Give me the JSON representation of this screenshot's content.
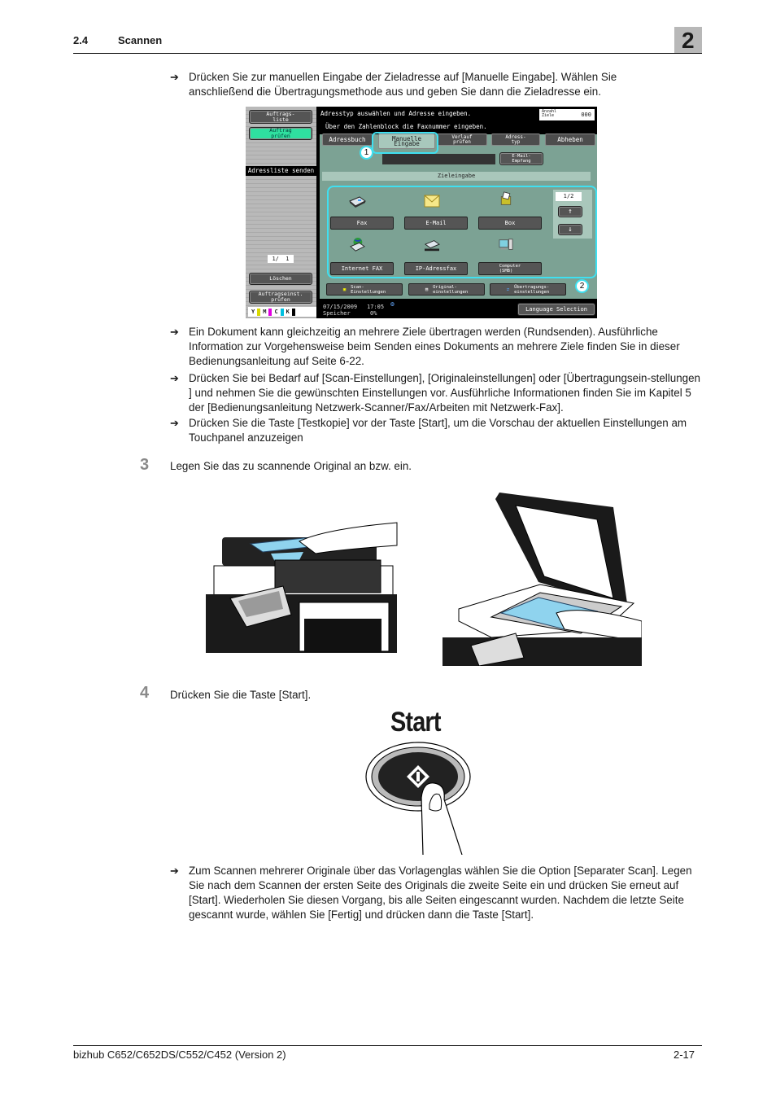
{
  "header": {
    "section_number": "2.4",
    "section_title": "Scannen",
    "chapter_number": "2"
  },
  "intro_bullet": "Drücken Sie zur manuellen Eingabe der Zieladresse auf [Manuelle Eingabe]. Wählen Sie anschließend die Übertragungsmethode aus und geben Sie dann die Zieladresse ein.",
  "touch_panel": {
    "left_panel": {
      "job_list_button": "Auftrags-\nliste",
      "check_job_button": "Auftrag\nprüfen",
      "address_list_label": "Adressliste senden",
      "page_counter": "1/  1",
      "delete_button": "Löschen",
      "check_job_settings_button": "Auftragseinst.\nprüfen",
      "toner": [
        {
          "label": "Y",
          "color": "#d8d800"
        },
        {
          "label": "M",
          "color": "#e000e0"
        },
        {
          "label": "C",
          "color": "#00c0e0"
        },
        {
          "label": "K",
          "color": "#000000"
        }
      ]
    },
    "message_line1": "Adresstyp auswählen und Adresse eingeben.",
    "message_line2": "Über den Zahlenblock die Faxnummer eingeben.",
    "dest_count_label": "Anzahl\nZiele",
    "dest_count_value": "000",
    "tabs": [
      {
        "label": "Adressbuch",
        "active": false
      },
      {
        "label": "Manuelle\nEingabe",
        "active": true
      },
      {
        "label": "Verlauf\nprüfen",
        "active": false
      },
      {
        "label": "Adress-\ntyp",
        "active": false
      },
      {
        "label": "Abheben",
        "active": false
      }
    ],
    "email_receive_button": "E-Mail-\nEmpfang",
    "section_label": "Zieleingabe",
    "destinations": [
      {
        "label": "Fax",
        "icon": "fax-icon"
      },
      {
        "label": "E-Mail",
        "icon": "envelope-icon"
      },
      {
        "label": "Box",
        "icon": "box-icon"
      },
      {
        "label": "Internet FAX",
        "icon": "internet-fax-icon"
      },
      {
        "label": "IP-Adressfax",
        "icon": "ip-fax-icon"
      },
      {
        "label": "Computer\n(SMB)",
        "icon": "computer-icon"
      }
    ],
    "pager": {
      "label": "1/2",
      "up_icon": "arrow-up-icon",
      "down_icon": "arrow-down-icon"
    },
    "settings_buttons": [
      {
        "label": "Scan-\nEinstellungen",
        "icon": "scan-settings-icon"
      },
      {
        "label": "Original-\neinstellungen",
        "icon": "original-settings-icon"
      },
      {
        "label": "Übertragungs-\neinstellungen",
        "icon": "transmission-settings-icon"
      }
    ],
    "status": {
      "date": "07/15/2009",
      "time": "17:05",
      "memory_label": "Speicher",
      "memory_value": "0%"
    },
    "language_button": "Language Selection",
    "callouts": [
      "1",
      "2"
    ]
  },
  "bullets_after_panel": [
    "Ein Dokument kann gleichzeitig an mehrere Ziele übertragen werden (Rundsenden). Ausführliche Information zur Vorgehensweise beim Senden eines Dokuments an mehrere Ziele finden Sie in dieser Bedienungsanleitung auf Seite 6-22.",
    "Drücken Sie bei Bedarf auf [Scan-Einstellungen], [Originaleinstellungen] oder [Übertragungsein-stellungen ] und nehmen Sie die gewünschten Einstellungen vor. Ausführliche Informationen finden Sie im Kapitel 5 der [Bedienungsanleitung Netzwerk-Scanner/Fax/Arbeiten mit Netzwerk-Fax].",
    "Drücken Sie die Taste [Testkopie] vor der Taste [Start], um die Vorschau der aktuellen Einstellungen am Touchpanel anzuzeigen"
  ],
  "steps": [
    {
      "number": "3",
      "text": "Legen Sie das zu scannende Original an bzw. ein."
    },
    {
      "number": "4",
      "text": "Drücken Sie die Taste [Start]."
    }
  ],
  "start_key_label": "Start",
  "final_bullet": "Zum Scannen mehrerer Originale über das Vorlagenglas wählen Sie die Option [Separater Scan]. Legen Sie nach dem Scannen der ersten Seite des Originals die zweite Seite ein und drücken Sie erneut auf [Start]. Wiederholen Sie diesen Vorgang, bis alle Seiten eingescannt wurden. Nachdem die letzte Seite gescannt wurde, wählen Sie [Fertig] und drücken dann die Taste [Start].",
  "footer": {
    "product": "bizhub C652/C652DS/C552/C452 (Version 2)",
    "page": "2-17"
  },
  "arrow_glyph": "➔",
  "colors": {
    "highlight_cyan": "#3fe0f0",
    "panel_green": "#7ca294",
    "button_green": "#2fe0a0",
    "document_blue": "#8fd3ee"
  }
}
